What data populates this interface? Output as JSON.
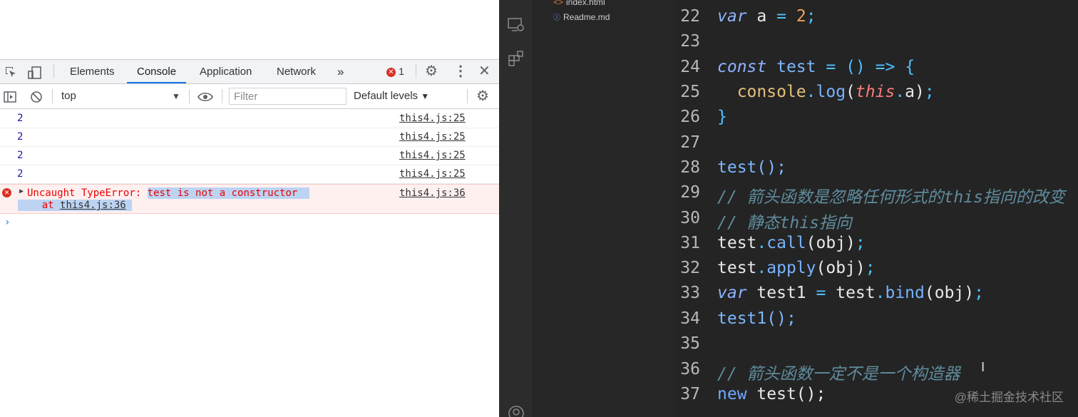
{
  "devtools": {
    "tabs": [
      "Elements",
      "Console",
      "Application",
      "Network"
    ],
    "more_tabs": "»",
    "error_count": "1",
    "context": "top",
    "filter_placeholder": "Filter",
    "levels": "Default levels",
    "logs": [
      {
        "value": "2",
        "source": "this4.js:25"
      },
      {
        "value": "2",
        "source": "this4.js:25"
      },
      {
        "value": "2",
        "source": "this4.js:25"
      },
      {
        "value": "2",
        "source": "this4.js:25"
      }
    ],
    "error": {
      "prefix": "Uncaught TypeError:",
      "message": "test is not a constructor",
      "at": "at",
      "at_location": "this4.js:36",
      "source": "this4.js:36"
    },
    "prompt": "›"
  },
  "explorer": {
    "files": [
      {
        "icon": "<>",
        "name": "index.html"
      },
      {
        "icon": "ⓘ",
        "name": "Readme.md"
      }
    ]
  },
  "editor": {
    "lines": [
      {
        "n": "22"
      },
      {
        "n": "23"
      },
      {
        "n": "24"
      },
      {
        "n": "25"
      },
      {
        "n": "26"
      },
      {
        "n": "27"
      },
      {
        "n": "28"
      },
      {
        "n": "29"
      },
      {
        "n": "30"
      },
      {
        "n": "31"
      },
      {
        "n": "32"
      },
      {
        "n": "33"
      },
      {
        "n": "34"
      },
      {
        "n": "35"
      },
      {
        "n": "36"
      },
      {
        "n": "37"
      }
    ],
    "tokens": {
      "var": "var",
      "a": "a",
      "eq": "=",
      "two": "2",
      "semi": ";",
      "const": "const",
      "test": "test",
      "arrow_paren": "()",
      "arrow": "=>",
      "lbrace": "{",
      "console": "console",
      "dot": ".",
      "log": "log",
      "lp": "(",
      "this": "this",
      "rp": ")",
      "rbrace": "}",
      "call_test": "test();",
      "comment29": "// 箭头函数是忽略任何形式的this指向的改变",
      "comment30": "// 静态this指向",
      "call": "call",
      "apply": "apply",
      "bind": "bind",
      "obj": "obj",
      "test1": "test1",
      "call_test1": "();",
      "comment36": "// 箭头函数一定不是一个构造器",
      "new": "new",
      "new_rest": "test();"
    }
  },
  "watermark": "@稀土掘金技术社区"
}
